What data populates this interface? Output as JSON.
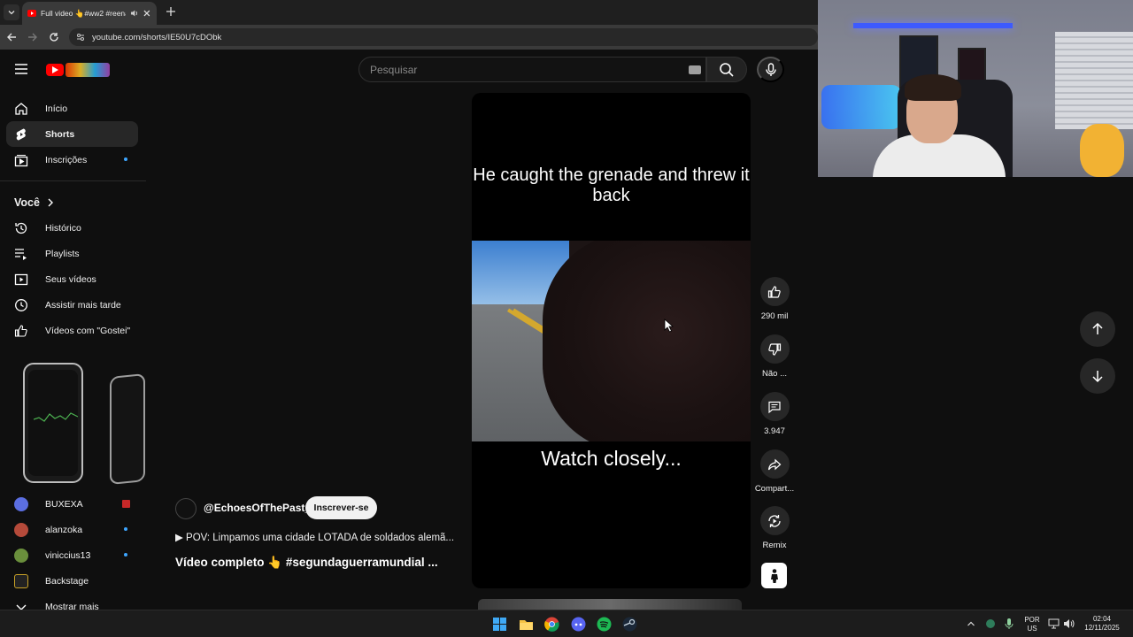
{
  "browser": {
    "tab_title": "Full video 👆#ww2 #reena",
    "url": "youtube.com/shorts/IE50U7cDObk"
  },
  "masthead": {
    "search_placeholder": "Pesquisar"
  },
  "sidebar": {
    "items": [
      {
        "label": "Início",
        "icon": "home-icon"
      },
      {
        "label": "Shorts",
        "icon": "shorts-icon",
        "active": true
      },
      {
        "label": "Inscrições",
        "icon": "subscriptions-icon"
      }
    ],
    "you_section": {
      "title": "Você",
      "items": [
        {
          "label": "Histórico",
          "icon": "history-icon"
        },
        {
          "label": "Playlists",
          "icon": "playlists-icon"
        },
        {
          "label": "Seus vídeos",
          "icon": "your-videos-icon"
        },
        {
          "label": "Assistir mais tarde",
          "icon": "watch-later-icon"
        },
        {
          "label": "Vídeos com \"Gostei\"",
          "icon": "liked-icon"
        }
      ]
    },
    "subscriptions": [
      {
        "label": "BUXEXA"
      },
      {
        "label": "alanzoka"
      },
      {
        "label": "viniccius13"
      },
      {
        "label": "Backstage"
      }
    ],
    "show_more": "Mostrar mais"
  },
  "short": {
    "caption_top": "He caught the grenade and threw it back",
    "caption_bottom": "Watch closely...",
    "channel": "@EchoesOfThePast_",
    "subscribe_label": "Inscrever-se",
    "pov_text": "▶  POV: Limpamos uma cidade LOTADA de soldados alemã...",
    "title": "Vídeo completo 👆 #segundaguerramundial ..."
  },
  "actions": {
    "likes": "290 mil",
    "dislike": "Não ...",
    "comments": "3.947",
    "share": "Compart...",
    "remix": "Remix"
  },
  "taskbar": {
    "lang_top": "POR",
    "lang_bottom": "US",
    "time": "02:04",
    "date": "12/11/2025"
  },
  "colors": {
    "accent_red": "#ff0000",
    "badge_blue": "#3ea6ff",
    "background": "#0f0f0f"
  }
}
